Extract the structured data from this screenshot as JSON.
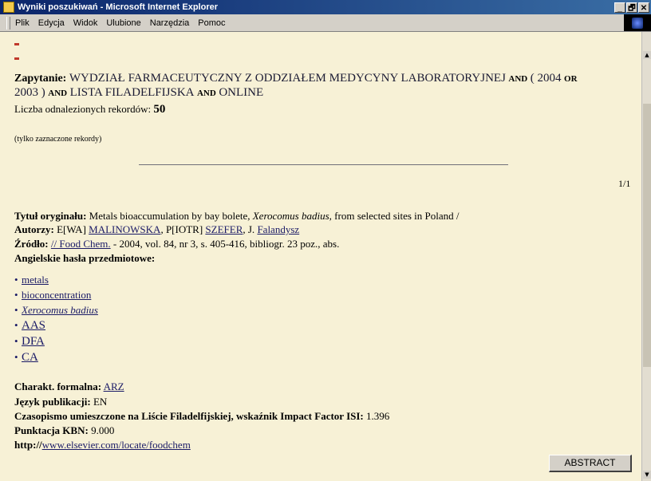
{
  "window": {
    "title": "Wyniki poszukiwań - Microsoft Internet Explorer",
    "buttons": [
      "_",
      "🗗",
      "✕"
    ]
  },
  "menu": [
    "Plik",
    "Edycja",
    "Widok",
    "Ulubione",
    "Narzędzia",
    "Pomoc"
  ],
  "query": {
    "label": "Zapytanie:",
    "part1": "WYDZIAŁ FARMACEUTYCZNY Z ODDZIAŁEM MEDYCYNY LABORATORYJNEJ",
    "op_and1": "AND",
    "paren_open": "( 2004",
    "op_or": "OR",
    "year2": "2003 )",
    "op_and2": "AND",
    "part2": "LISTA FILADELFIJSKA",
    "op_and3": "AND",
    "part3": "ONLINE"
  },
  "count": {
    "label": "Liczba odnalezionych rekordów:",
    "value": "50"
  },
  "note": "(tylko zaznaczone rekordy)",
  "page_indicator": "1/1",
  "record": {
    "title_label": "Tytuł oryginału:",
    "title_text1": "Metals bioaccumulation by bay bolete,",
    "title_italic": "Xerocomus badius",
    "title_text2": ", from selected sites in Poland /",
    "authors_label": "Autorzy:",
    "author1_prefix": "E[WA]",
    "author1_link": "MALINOWSKA",
    "author2_prefix": ", P[IOTR]",
    "author2_link": "SZEFER",
    "author3_prefix": ", J.",
    "author3_link": "Falandysz",
    "source_label": "Źródło:",
    "source_link": "// Food Chem.",
    "source_text": " - 2004, vol. 84, nr 3, s. 405-416, bibliogr. 23 poz., abs.",
    "subjects_label": "Angielskie hasła przedmiotowe:",
    "subjects": [
      "metals",
      "bioconcentration",
      "Xerocomus badius",
      "AAS",
      "DFA",
      "CA"
    ],
    "formal_label": "Charakt. formalna:",
    "formal_value": "ARZ",
    "language_label": "Język publikacji:",
    "language_value": "EN",
    "journal_label": "Czasopismo umieszczone na Liście Filadelfijskiej, wskaźnik Impact Factor ISI:",
    "journal_value": "1.396",
    "kbn_label": "Punktacja KBN:",
    "kbn_value": "9.000",
    "url_prefix": "http://",
    "url_link": "www.elsevier.com/locate/foodchem"
  },
  "abstract_button": "ABSTRACT"
}
